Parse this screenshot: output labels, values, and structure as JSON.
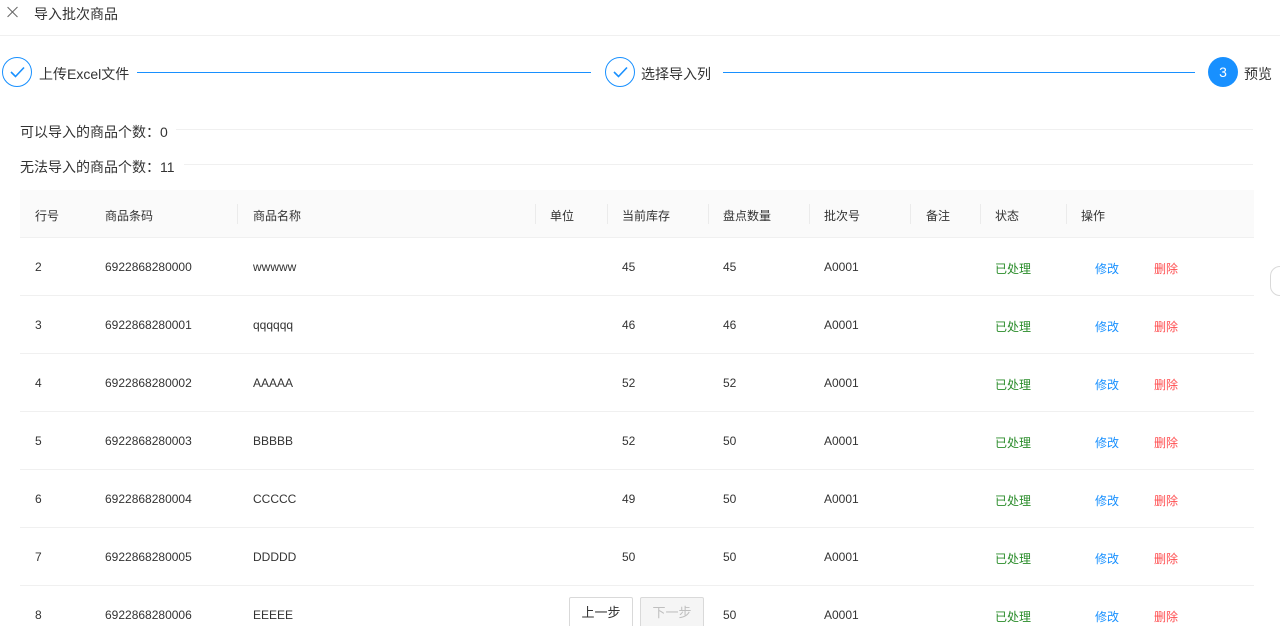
{
  "header": {
    "title": "导入批次商品"
  },
  "steps": [
    {
      "label": "上传Excel文件",
      "state": "done"
    },
    {
      "label": "选择导入列",
      "state": "done"
    },
    {
      "label": "预览",
      "state": "active",
      "number": "3"
    }
  ],
  "summary": {
    "importable": "可以导入的商品个数：0",
    "not_importable": "无法导入的商品个数：11"
  },
  "table": {
    "headers": [
      "行号",
      "商品条码",
      "商品名称",
      "单位",
      "当前库存",
      "盘点数量",
      "批次号",
      "备注",
      "状态",
      "操作"
    ],
    "rows": [
      {
        "row": "2",
        "barcode": "6922868280000",
        "name": "wwwww",
        "unit": "",
        "stock": "45",
        "count": "45",
        "batch": "A0001",
        "note": "",
        "status": "已处理",
        "edit": "修改",
        "delete": "删除"
      },
      {
        "row": "3",
        "barcode": "6922868280001",
        "name": "qqqqqq",
        "unit": "",
        "stock": "46",
        "count": "46",
        "batch": "A0001",
        "note": "",
        "status": "已处理",
        "edit": "修改",
        "delete": "删除"
      },
      {
        "row": "4",
        "barcode": "6922868280002",
        "name": "AAAAA",
        "unit": "",
        "stock": "52",
        "count": "52",
        "batch": "A0001",
        "note": "",
        "status": "已处理",
        "edit": "修改",
        "delete": "删除"
      },
      {
        "row": "5",
        "barcode": "6922868280003",
        "name": "BBBBB",
        "unit": "",
        "stock": "52",
        "count": "50",
        "batch": "A0001",
        "note": "",
        "status": "已处理",
        "edit": "修改",
        "delete": "删除"
      },
      {
        "row": "6",
        "barcode": "6922868280004",
        "name": "CCCCC",
        "unit": "",
        "stock": "49",
        "count": "50",
        "batch": "A0001",
        "note": "",
        "status": "已处理",
        "edit": "修改",
        "delete": "删除"
      },
      {
        "row": "7",
        "barcode": "6922868280005",
        "name": "DDDDD",
        "unit": "",
        "stock": "50",
        "count": "50",
        "batch": "A0001",
        "note": "",
        "status": "已处理",
        "edit": "修改",
        "delete": "删除"
      },
      {
        "row": "8",
        "barcode": "6922868280006",
        "name": "EEEEE",
        "unit": "",
        "stock": "",
        "count": "50",
        "batch": "A0001",
        "note": "",
        "status": "已处理",
        "edit": "修改",
        "delete": "删除"
      }
    ]
  },
  "footer": {
    "prev_label": "上一步",
    "next_label": "下一步"
  },
  "colors": {
    "primary": "#1890ff",
    "success": "#2a8c2a",
    "danger": "#ff4d4f"
  }
}
